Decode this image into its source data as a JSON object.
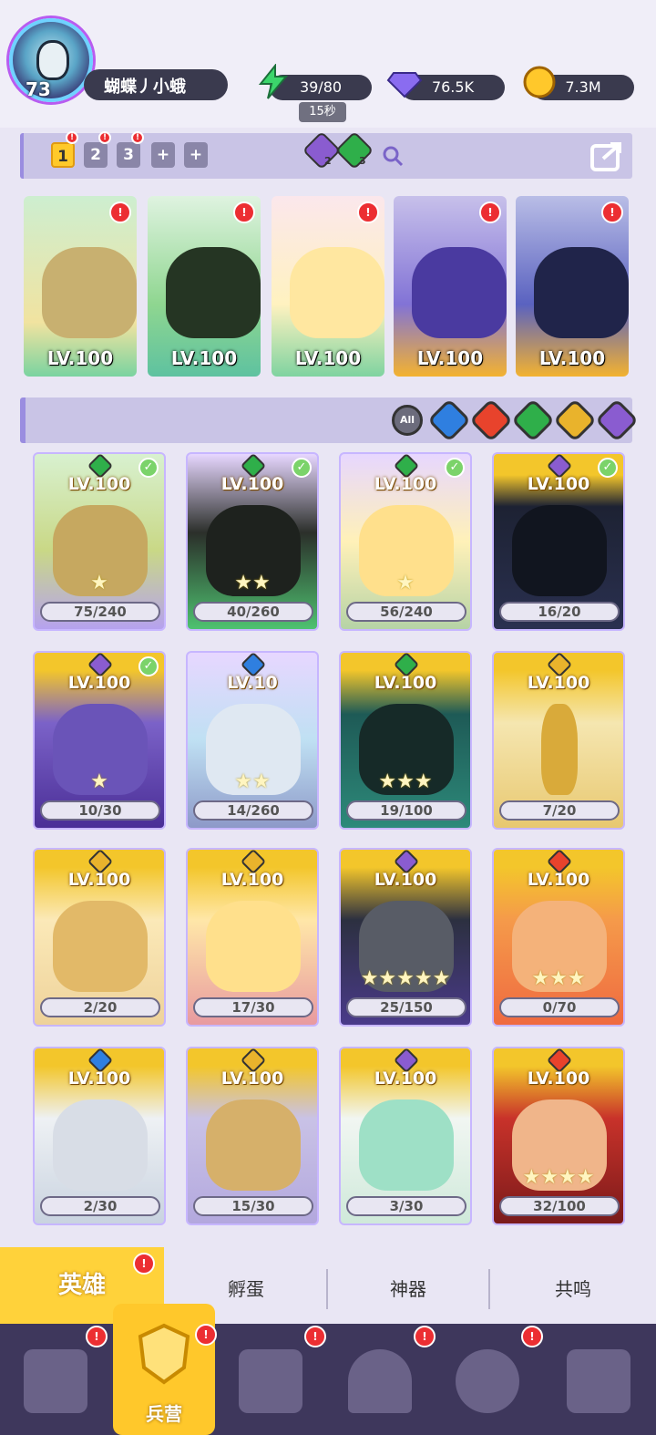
{
  "player": {
    "level": "73",
    "name": "蝴蝶丿小蛾"
  },
  "resources": {
    "energy": "39/80",
    "energy_timer": "15秒",
    "diamonds": "76.5K",
    "gold": "7.3M"
  },
  "team_tabs": [
    {
      "label": "1"
    },
    {
      "label": "2"
    },
    {
      "label": "3"
    },
    {
      "label": "+"
    },
    {
      "label": "+"
    }
  ],
  "team_gems": [
    {
      "count": "2"
    },
    {
      "count": "3"
    }
  ],
  "team_cards": [
    {
      "level": "LV.100"
    },
    {
      "level": "LV.100"
    },
    {
      "level": "LV.100"
    },
    {
      "level": "LV.100"
    },
    {
      "level": "LV.100"
    }
  ],
  "filters": [
    {
      "label": "All"
    },
    {
      "label": ""
    },
    {
      "label": ""
    },
    {
      "label": ""
    },
    {
      "label": ""
    },
    {
      "label": ""
    }
  ],
  "heroes": [
    {
      "level": "LV.100",
      "progress": "75/240"
    },
    {
      "level": "LV.100",
      "progress": "40/260"
    },
    {
      "level": "LV.100",
      "progress": "56/240"
    },
    {
      "level": "LV.100",
      "progress": "16/20"
    },
    {
      "level": "LV.100",
      "progress": "10/30"
    },
    {
      "level": "LV.10",
      "progress": "14/260"
    },
    {
      "level": "LV.100",
      "progress": "19/100"
    },
    {
      "level": "LV.100",
      "progress": "7/20"
    },
    {
      "level": "LV.100",
      "progress": "2/20"
    },
    {
      "level": "LV.100",
      "progress": "17/30"
    },
    {
      "level": "LV.100",
      "progress": "25/150"
    },
    {
      "level": "LV.100",
      "progress": "0/70"
    },
    {
      "level": "LV.100",
      "progress": "2/30"
    },
    {
      "level": "LV.100",
      "progress": "15/30"
    },
    {
      "level": "LV.100",
      "progress": "3/30"
    },
    {
      "level": "LV.100",
      "progress": "32/100"
    }
  ],
  "bottom_tabs": [
    {
      "label": "英雄"
    },
    {
      "label": "孵蛋"
    },
    {
      "label": "神器"
    },
    {
      "label": "共鸣"
    }
  ],
  "nav": {
    "active_label": "兵营"
  },
  "colors": {
    "gold": "#ffc82b",
    "purple": "#3e375c",
    "alert": "#ec2e32"
  }
}
